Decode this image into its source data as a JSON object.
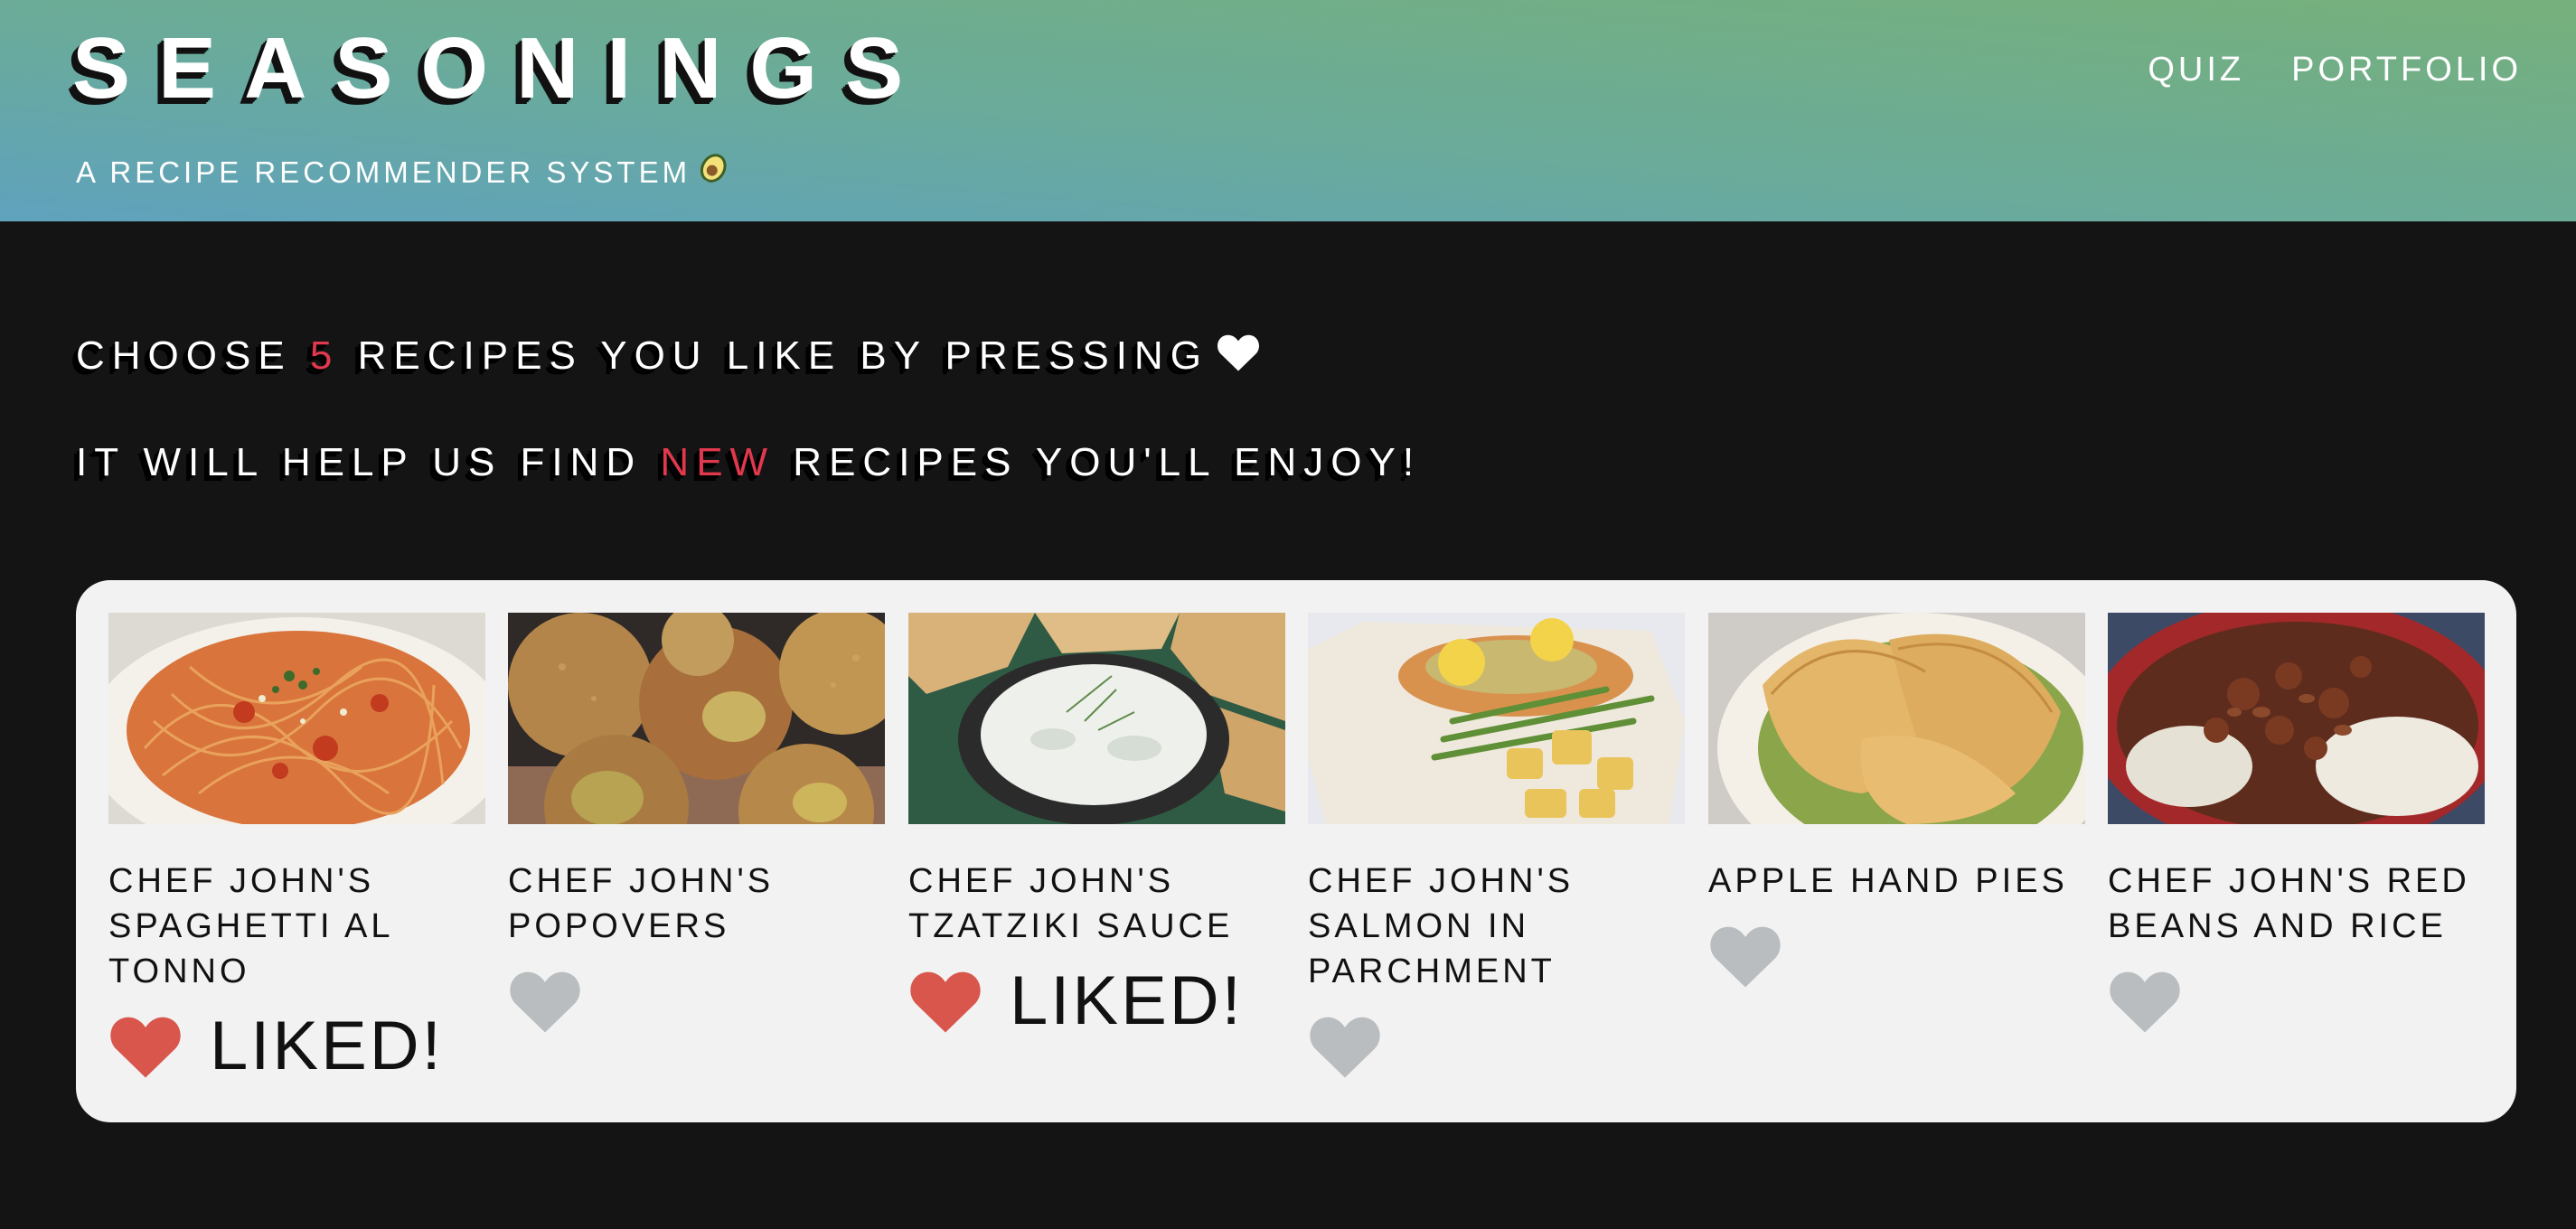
{
  "header": {
    "title": "SEASONINGS",
    "subtitle": "A RECIPE RECOMMENDER SYSTEM",
    "subtitle_icon": "avocado-icon",
    "nav": [
      {
        "label": "QUIZ"
      },
      {
        "label": "PORTFOLIO"
      }
    ]
  },
  "instructions": {
    "line1_before": "CHOOSE ",
    "line1_highlight": "5",
    "line1_after": " RECIPES YOU LIKE BY PRESSING",
    "line2_before": "IT WILL HELP US FIND ",
    "line2_highlight": "NEW",
    "line2_after": " RECIPES YOU'LL ENJOY!",
    "highlight_color": "#e0384d"
  },
  "colors": {
    "liked_heart": "#d8564c",
    "unliked_heart": "#b9bdbf",
    "header_gradient_start": "#5fa2bd",
    "header_gradient_end": "#76b07b"
  },
  "recipes": [
    {
      "title": "CHEF JOHN'S SPAGHETTI AL TONNO",
      "liked": true,
      "liked_label": "LIKED!",
      "image": "spaghetti-photo"
    },
    {
      "title": "CHEF JOHN'S POPOVERS",
      "liked": false,
      "liked_label": "",
      "image": "popovers-photo"
    },
    {
      "title": "CHEF JOHN'S TZATZIKI SAUCE",
      "liked": true,
      "liked_label": "LIKED!",
      "image": "tzatziki-photo"
    },
    {
      "title": "CHEF JOHN'S SALMON IN PARCHMENT",
      "liked": false,
      "liked_label": "",
      "image": "salmon-photo"
    },
    {
      "title": "APPLE HAND PIES",
      "liked": false,
      "liked_label": "",
      "image": "hand-pies-photo"
    },
    {
      "title": "CHEF JOHN'S RED BEANS AND RICE",
      "liked": false,
      "liked_label": "",
      "image": "red-beans-photo"
    }
  ]
}
